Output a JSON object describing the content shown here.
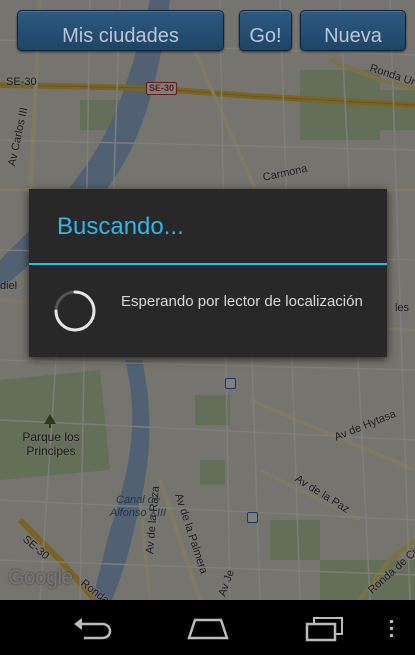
{
  "toolbar": {
    "cities_label": "Mis ciudades",
    "go_label": "Go!",
    "new_label": "Nueva"
  },
  "dialog": {
    "title": "Buscando...",
    "message": "Esperando por lector de localización"
  },
  "map": {
    "labels": {
      "se30_left": "SE-30",
      "se30_badge": "SE-30",
      "se30_bottom": "SE-30",
      "carlos": "Av Carlos III",
      "ronda_urbana": "Ronda Ur",
      "carmona": "Carmona",
      "diel": "diel",
      "les": "les",
      "parque": "Parque los Principes",
      "canal": "Canal de Alfonso XIII",
      "palmera": "Av de la Palmera",
      "raza": "Av de la Raza",
      "hytasa": "Av de Hytasa",
      "paz": "Av de la Paz",
      "ronda_cir": "Ronda de Cir",
      "ronda_bottom": "Ronda",
      "av_je": "Av Je"
    },
    "attribution": "Google"
  },
  "navbar": {
    "back": "back-icon",
    "home": "home-icon",
    "recents": "recent-apps-icon",
    "menu": "overflow-menu-icon"
  },
  "colors": {
    "accent": "#33b5e5",
    "dialog_bg": "#282828",
    "button_bg": "#2d5a82"
  }
}
